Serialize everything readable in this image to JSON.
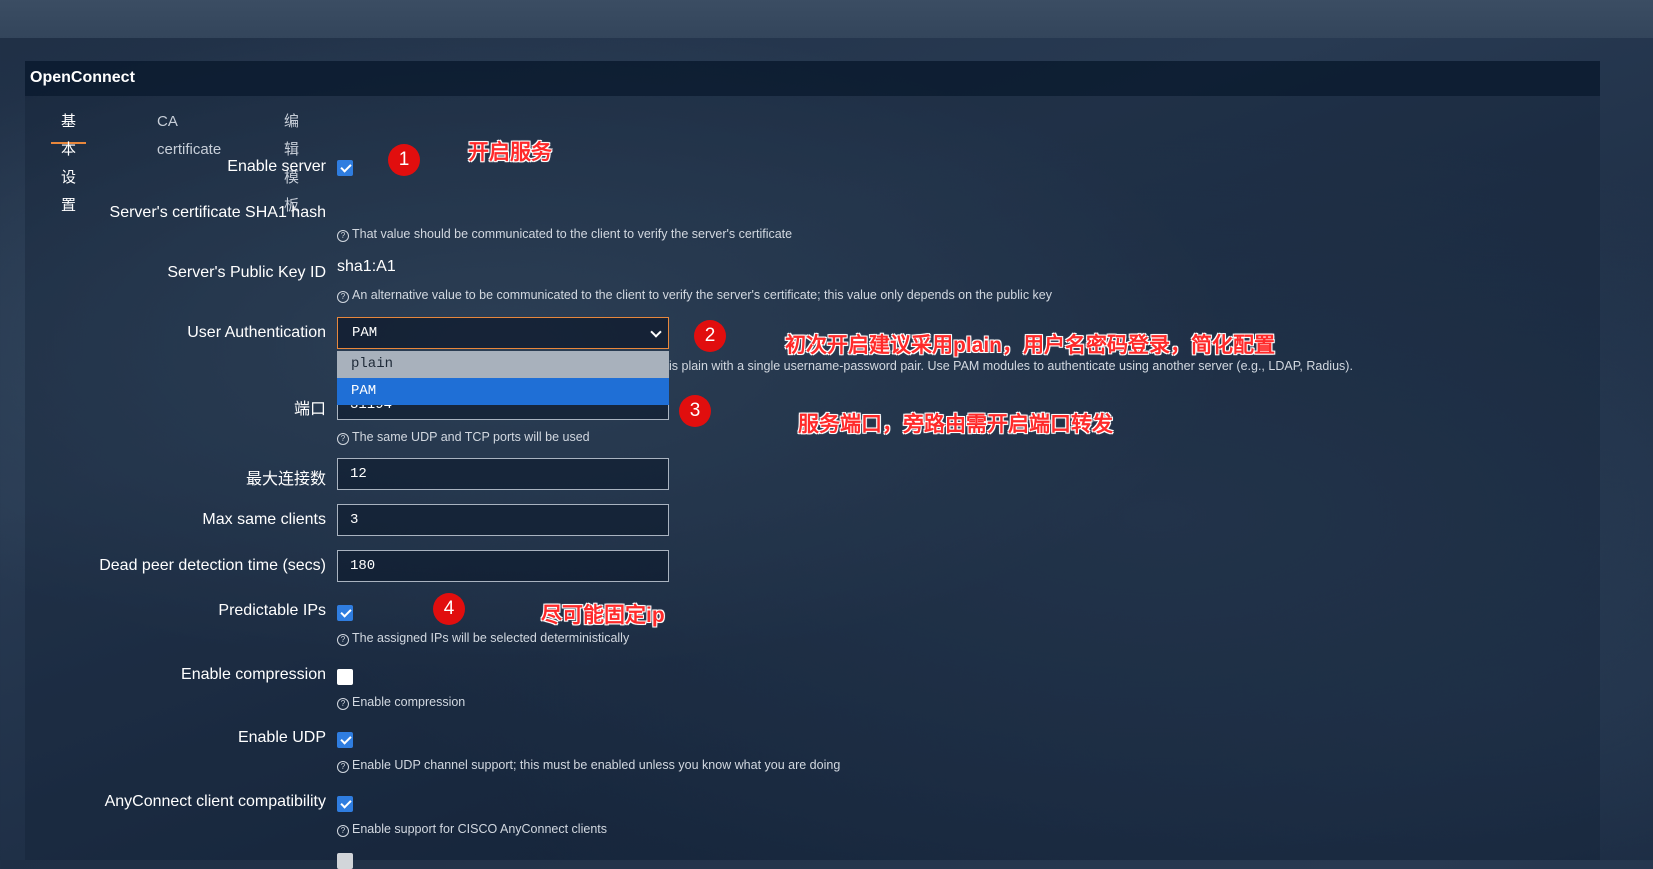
{
  "panel": {
    "title": "OpenConnect"
  },
  "tabs": [
    {
      "label": "基本设置",
      "active": true
    },
    {
      "label": "CA certificate",
      "active": false
    },
    {
      "label": "编辑模板",
      "active": false
    }
  ],
  "fields": {
    "enable_server": {
      "label": "Enable server",
      "checked": true
    },
    "sha1": {
      "label": "Server's certificate SHA1 hash",
      "hint": "That value should be communicated to the client to verify the server's certificate"
    },
    "pubkey": {
      "label": "Server's Public Key ID",
      "value": "sha1:A1",
      "hint": "An alternative value to be communicated to the client to verify the server's certificate; this value only depends on the public key"
    },
    "auth": {
      "label": "User Authentication",
      "value": "PAM",
      "options": [
        "plain",
        "PAM"
      ],
      "hint_visible": "is plain with a single username-password pair. Use PAM modules to authenticate using another server (e.g., LDAP, Radius)."
    },
    "port": {
      "label": "端口",
      "value_partial": "31194",
      "hint": "The same UDP and TCP ports will be used"
    },
    "max_clients": {
      "label": "最大连接数",
      "value": "12"
    },
    "max_same": {
      "label": "Max same clients",
      "value": "3"
    },
    "dpd": {
      "label": "Dead peer detection time (secs)",
      "value": "180"
    },
    "predictable": {
      "label": "Predictable IPs",
      "checked": true,
      "hint": "The assigned IPs will be selected deterministically"
    },
    "compression": {
      "label": "Enable compression",
      "checked": false,
      "hint": "Enable compression"
    },
    "udp": {
      "label": "Enable UDP",
      "checked": true,
      "hint": "Enable UDP channel support; this must be enabled unless you know what you are doing"
    },
    "anyconnect": {
      "label": "AnyConnect client compatibility",
      "checked": true,
      "hint": "Enable support for CISCO AnyConnect clients"
    }
  },
  "annotations": [
    {
      "badge": "1",
      "text": "开启服务"
    },
    {
      "badge": "2",
      "text": "初次开启建议采用plain，用户名密码登录，简化配置"
    },
    {
      "badge": "3",
      "text": "服务端口，旁路由需开启端口转发"
    },
    {
      "badge": "4",
      "text": "尽可能固定ip"
    }
  ],
  "colors": {
    "accent_tab": "#e8873c",
    "checkbox": "#2f7de0",
    "annotation_red": "#ff2a2a",
    "badge_red": "#e10e0e"
  }
}
